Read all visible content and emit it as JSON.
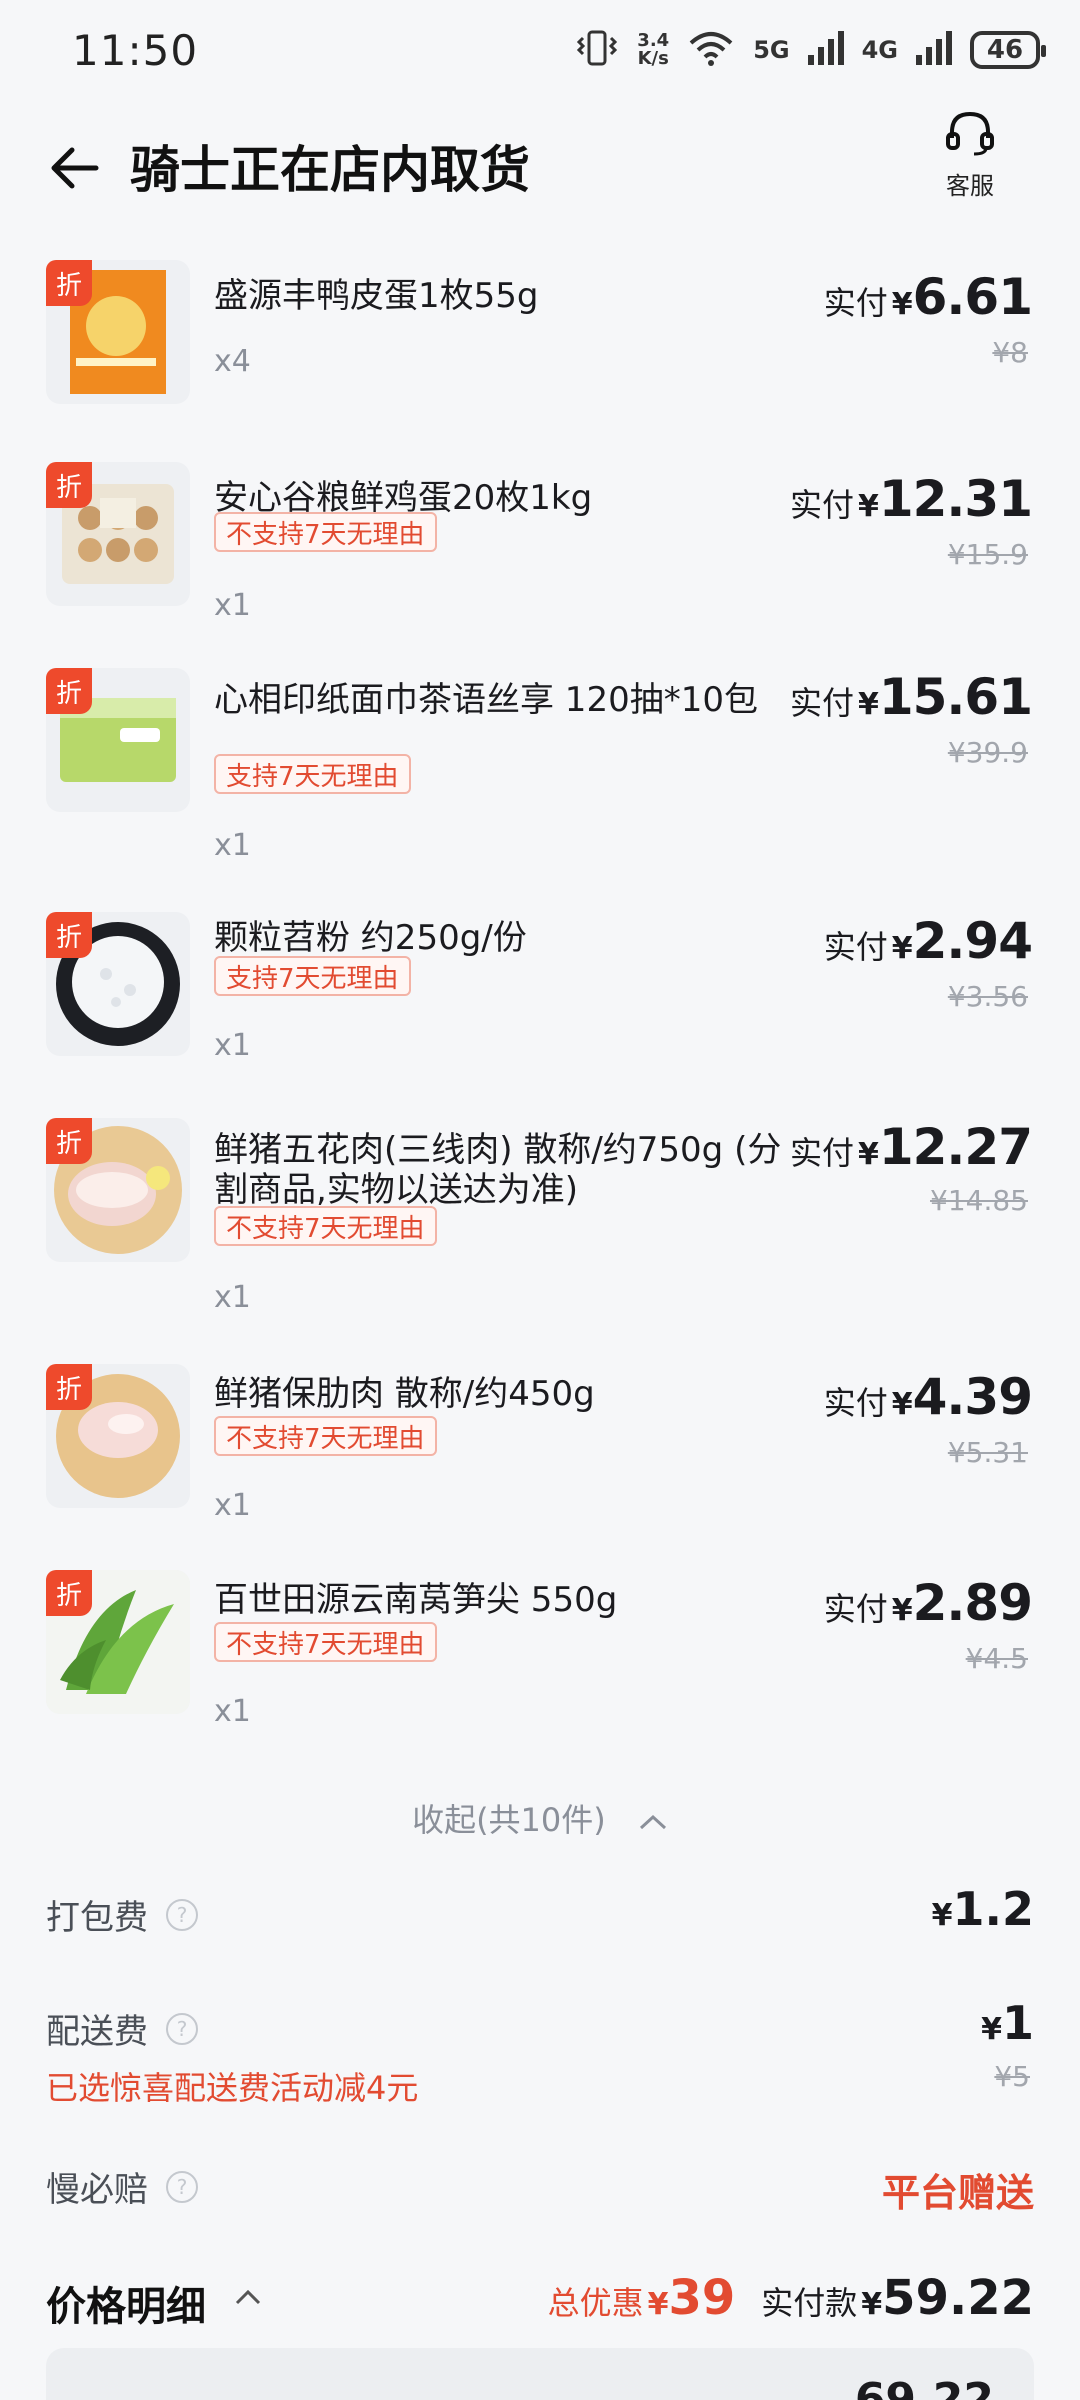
{
  "status_bar": {
    "time": "11:50",
    "net_speed_top": "3.4",
    "net_speed_bottom": "K/s",
    "sig1": "5G",
    "sig2": "4G",
    "battery": "46"
  },
  "header": {
    "title": "骑士正在店内取货",
    "service_label": "客服"
  },
  "discount_tag": "折",
  "pay_label": "实付",
  "currency": "¥",
  "items": [
    {
      "name": "盛源丰鸭皮蛋1枚55g",
      "badge": "",
      "qty": "x4",
      "pay": "6.61",
      "orig": "¥8"
    },
    {
      "name": "安心谷粮鲜鸡蛋20枚1kg",
      "badge": "不支持7天无理由",
      "qty": "x1",
      "pay": "12.31",
      "orig": "¥15.9"
    },
    {
      "name": "心相印纸面巾茶语丝享 120抽*10包",
      "badge": "支持7天无理由",
      "qty": "x1",
      "pay": "15.61",
      "orig": "¥39.9"
    },
    {
      "name": "颗粒苕粉 约250g/份",
      "badge": "支持7天无理由",
      "qty": "x1",
      "pay": "2.94",
      "orig": "¥3.56"
    },
    {
      "name": "鲜猪五花肉(三线肉) 散称/约750g (分割商品,实物以送达为准)",
      "badge": "不支持7天无理由",
      "qty": "x1",
      "pay": "12.27",
      "orig": "¥14.85"
    },
    {
      "name": "鲜猪保肋肉 散称/约450g",
      "badge": "不支持7天无理由",
      "qty": "x1",
      "pay": "4.39",
      "orig": "¥5.31"
    },
    {
      "name": "百世田源云南莴笋尖 550g",
      "badge": "不支持7天无理由",
      "qty": "x1",
      "pay": "2.89",
      "orig": "¥4.5"
    }
  ],
  "collapse_label": "收起(共10件)",
  "fees": {
    "packing_label": "打包费",
    "packing_value": "1.2",
    "delivery_label": "配送费",
    "delivery_value": "1",
    "delivery_orig": "¥5",
    "delivery_note": "已选惊喜配送费活动减4元",
    "slow_label": "慢必赔",
    "slow_value": "平台赠送"
  },
  "price_detail": {
    "title": "价格明细",
    "discount_label": "总优惠",
    "discount_value": "39",
    "total_label": "实付款",
    "total_value": "59.22"
  },
  "bottom_peek": "69.22"
}
